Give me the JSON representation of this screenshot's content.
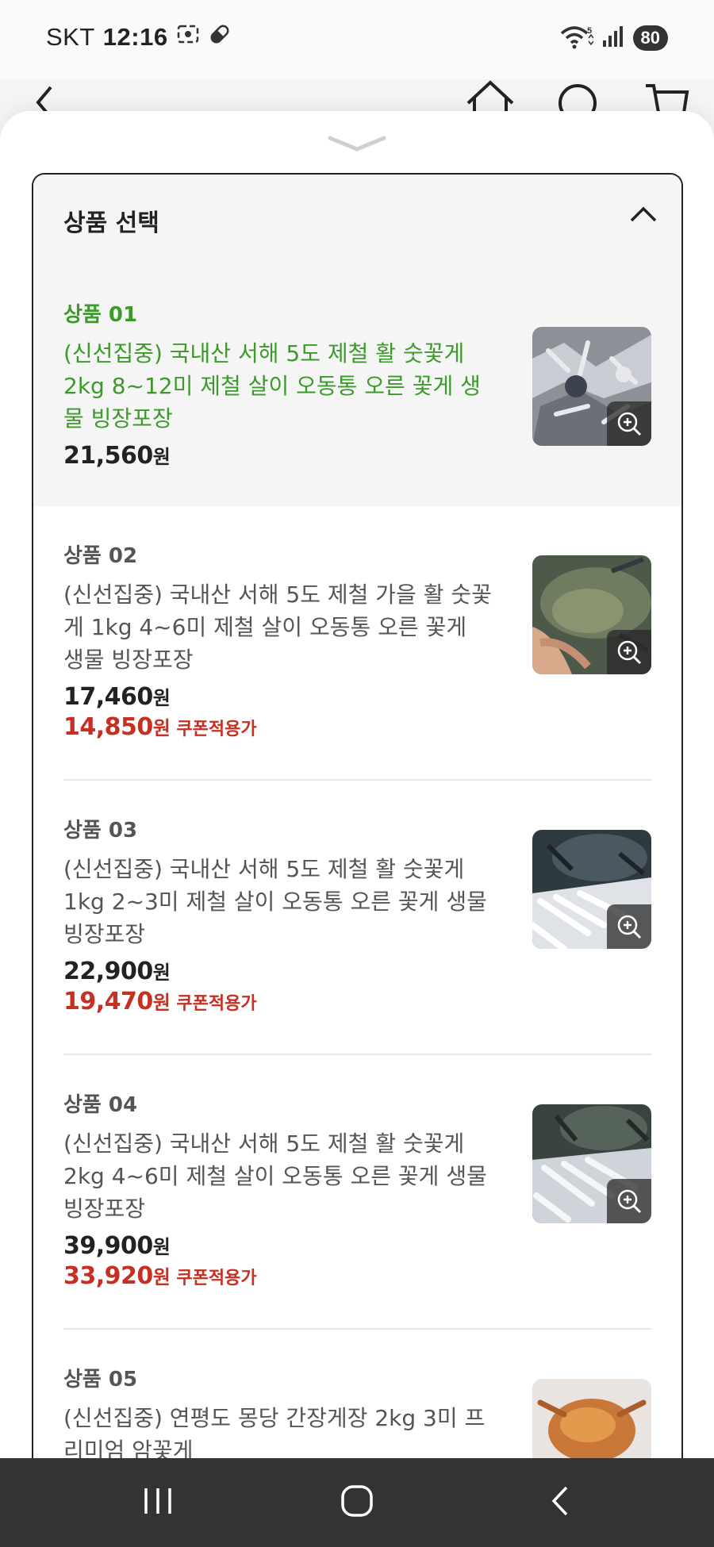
{
  "status": {
    "carrier": "SKT",
    "time": "12:16",
    "battery": "80",
    "network_badge": "5"
  },
  "icons": {
    "back": "back-arrow-icon",
    "home": "home-icon",
    "search": "search-icon",
    "cart": "cart-icon",
    "zoom": "zoom-in-icon"
  },
  "panel": {
    "title": "상품 선택"
  },
  "products": [
    {
      "label": "상품 01",
      "name": "(신선집중) 국내산 서해 5도 제철 활 숫꽃게 2kg 8~12미 제철 살이 오동통 오른 꽃게 생물 빙장포장",
      "price": "21,560",
      "unit": "원",
      "selected": true
    },
    {
      "label": "상품 02",
      "name": "(신선집중) 국내산 서해 5도 제철 가을 활 숫꽃게 1kg 4~6미 제철 살이 오동통 오른 꽃게 생물 빙장포장",
      "price": "17,460",
      "unit": "원",
      "sale_price": "14,850",
      "sale_unit": "원",
      "sale_tag": "쿠폰적용가"
    },
    {
      "label": "상품 03",
      "name": "(신선집중) 국내산 서해 5도 제철 활 숫꽃게 1kg 2~3미 제철 살이 오동통 오른 꽃게 생물 빙장포장",
      "price": "22,900",
      "unit": "원",
      "sale_price": "19,470",
      "sale_unit": "원",
      "sale_tag": "쿠폰적용가"
    },
    {
      "label": "상품 04",
      "name": "(신선집중) 국내산 서해 5도 제철 활 숫꽃게 2kg 4~6미 제철 살이 오동통 오른 꽃게 생물 빙장포장",
      "price": "39,900",
      "unit": "원",
      "sale_price": "33,920",
      "sale_unit": "원",
      "sale_tag": "쿠폰적용가"
    },
    {
      "label": "상품 05",
      "name": "(신선집중) 연평도 몽당 간장게장 2kg 3미 프리미엄 암꽃게"
    }
  ],
  "colors": {
    "selected_green": "#3c9a2a",
    "sale_red": "#c62f22",
    "nav_bar": "#333333"
  }
}
